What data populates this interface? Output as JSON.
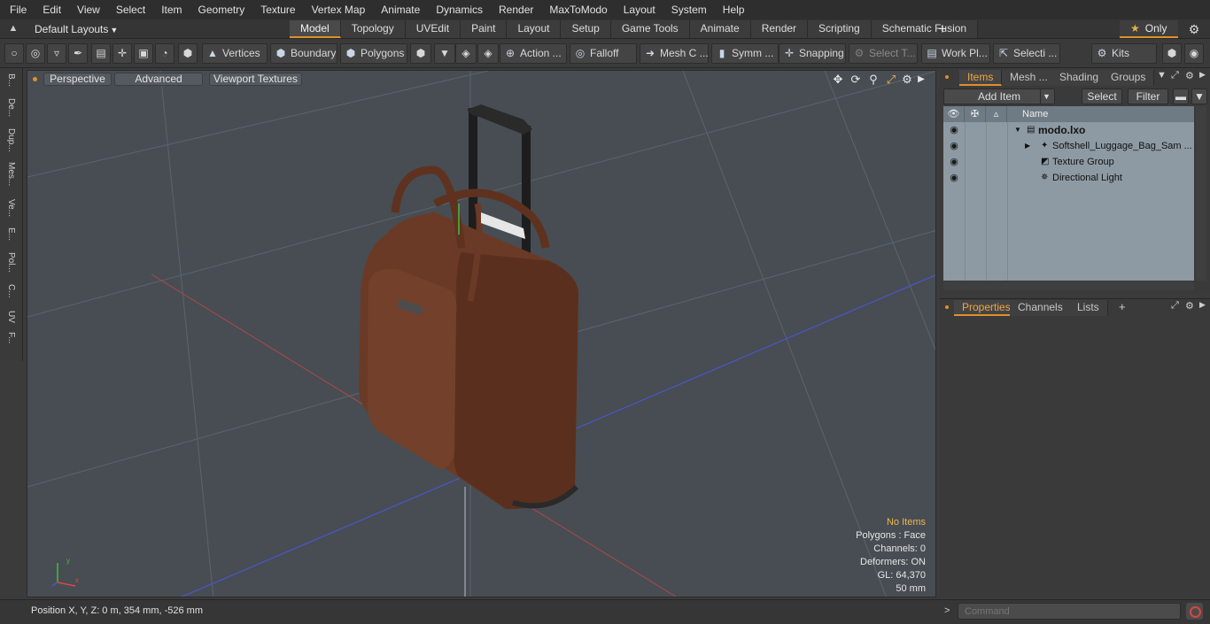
{
  "menu": [
    "File",
    "Edit",
    "View",
    "Select",
    "Item",
    "Geometry",
    "Texture",
    "Vertex Map",
    "Animate",
    "Dynamics",
    "Render",
    "MaxToModo",
    "Layout",
    "System",
    "Help"
  ],
  "layout": {
    "dropdown": "Default Layouts",
    "tabs": [
      "Model",
      "Topology",
      "UVEdit",
      "Paint",
      "Layout",
      "Setup",
      "Game Tools",
      "Animate",
      "Render",
      "Scripting",
      "Schematic Fusion"
    ],
    "active_tab": "Model",
    "only_label": "Only"
  },
  "toolbar": {
    "vertices": "Vertices",
    "boundary": "Boundary",
    "polygons": "Polygons",
    "action": "Action ...",
    "falloff": "Falloff",
    "mesh_c": "Mesh C ...",
    "symm": "Symm ...",
    "snapping": "Snapping",
    "select_t": "Select T...",
    "work_pl": "Work Pl...",
    "selecti": "Selecti ...",
    "kits": "Kits"
  },
  "side_tabs": [
    "B...",
    "De...",
    "Dup...",
    "Mes...",
    "Ve...",
    "E...",
    "Pol...",
    "C...",
    "UV",
    "F..."
  ],
  "viewport": {
    "view_mode": "Perspective",
    "advanced": "Advanced",
    "textures": "Viewport Textures",
    "info": {
      "items": "No Items",
      "polygons": "Polygons : Face",
      "channels": "Channels: 0",
      "deformers": "Deformers: ON",
      "gl": "GL: 64,370",
      "scale": "50 mm"
    },
    "colors": {
      "background": "#474d53",
      "grid": "#5c646b",
      "x_axis": "#b04a44",
      "z_axis": "#4d56c8",
      "y_axis": "#b9c0c5",
      "bag": "#6b3a26"
    }
  },
  "items_panel": {
    "tabs": [
      "Items",
      "Mesh ...",
      "Shading",
      "Groups"
    ],
    "active_tab": "Items",
    "add_item": "Add Item",
    "select": "Select",
    "filter": "Filter",
    "name_header": "Name",
    "tree": [
      {
        "label": "modo.lxo",
        "icon": "scene-icon",
        "bold": true
      },
      {
        "label": "Softshell_Luggage_Bag_Sam ...",
        "icon": "mesh-icon"
      },
      {
        "label": "Texture Group",
        "icon": "texture-group-icon"
      },
      {
        "label": "Directional Light",
        "icon": "light-icon"
      }
    ]
  },
  "properties_panel": {
    "tabs": [
      "Properties",
      "Channels",
      "Lists"
    ],
    "active_tab": "Properties"
  },
  "status": {
    "position": "Position X, Y, Z:   0 m, 354 mm, -526 mm",
    "command_placeholder": "Command"
  }
}
